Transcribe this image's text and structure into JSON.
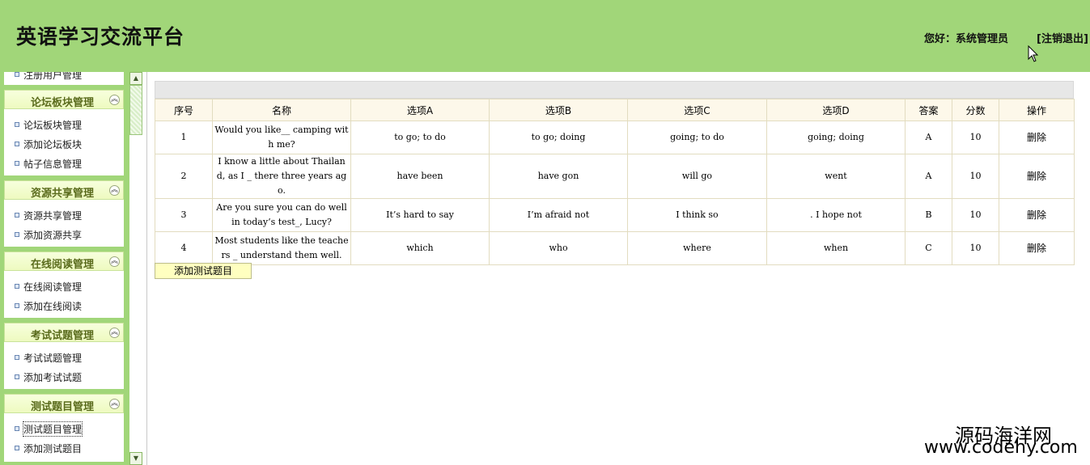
{
  "header": {
    "title": "英语学习交流平台",
    "greeting": "您好：系统管理员",
    "logout": "[注销退出]"
  },
  "sidebar": {
    "top_partial_item": "注册用户管理",
    "groups": [
      {
        "title": "论坛板块管理",
        "items": [
          "论坛板块管理",
          "添加论坛板块",
          "帖子信息管理"
        ]
      },
      {
        "title": "资源共享管理",
        "items": [
          "资源共享管理",
          "添加资源共享"
        ]
      },
      {
        "title": "在线阅读管理",
        "items": [
          "在线阅读管理",
          "添加在线阅读"
        ]
      },
      {
        "title": "考试试题管理",
        "items": [
          "考试试题管理",
          "添加考试试题"
        ]
      },
      {
        "title": "测试题目管理",
        "items": [
          "测试题目管理",
          "添加测试题目"
        ]
      }
    ],
    "collapse_glyph": "︽"
  },
  "table": {
    "headers": [
      "序号",
      "名称",
      "选项A",
      "选项B",
      "选项C",
      "选项D",
      "答案",
      "分数",
      "操作"
    ],
    "rows": [
      [
        "1",
        "Would you like__ camping with me?",
        "to go; to do",
        "to go; doing",
        "going; to do",
        "going; doing",
        "A",
        "10",
        "删除"
      ],
      [
        "2",
        "I know a little about Thailand, as I _ there three years ago.",
        "have been",
        "have gon",
        "will go",
        "went",
        "A",
        "10",
        "删除"
      ],
      [
        "3",
        "Are you sure you can do well in today’s test_, Lucy?",
        "It’s hard to say",
        "I’m afraid not",
        "I think so",
        ". I hope not",
        "B",
        "10",
        "删除"
      ],
      [
        "4",
        "Most students like the teachers _ understand them well.",
        "which",
        "who",
        "where",
        "when",
        "C",
        "10",
        "删除"
      ]
    ]
  },
  "add_button": "添加测试题目",
  "watermark": {
    "line1": "源码海洋网",
    "line2": "www.codehy.com"
  },
  "colors": {
    "header_bg": "#a1d679",
    "group_head_bg": "#eefac0",
    "table_header_bg": "#fdf8ea",
    "button_bg": "#ffffc0"
  }
}
